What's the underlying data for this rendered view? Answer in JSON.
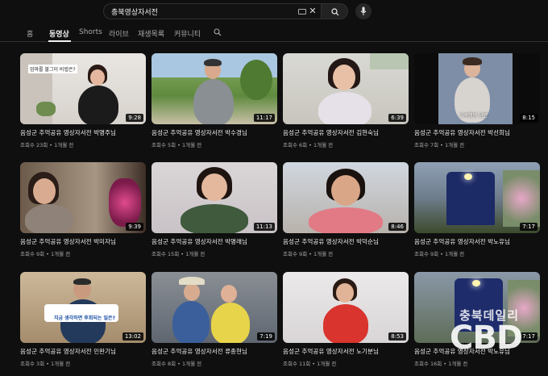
{
  "search": {
    "query": "충북영상자서전"
  },
  "tabs": [
    {
      "label": "홈"
    },
    {
      "label": "동영상"
    },
    {
      "label": "Shorts"
    },
    {
      "label": "라이브"
    },
    {
      "label": "재생목록"
    },
    {
      "label": "커뮤니티"
    }
  ],
  "videos": [
    {
      "title": "음성군 추억공유 영상자서전 박명주님",
      "views": "조회수 23회",
      "age": "1개월 전",
      "duration": "9:28",
      "overlay": "엄마를 불그이 비법은?"
    },
    {
      "title": "음성군 추억공유 영상자서전 박수경님",
      "views": "조회수 5회",
      "age": "1개월 전",
      "duration": "11:17",
      "overlay": ""
    },
    {
      "title": "음성군 추억공유 영상자서전 김현숙님",
      "views": "조회수 6회",
      "age": "1개월 전",
      "duration": "6:39",
      "overlay": ""
    },
    {
      "title": "음성군 추억공유 영상자서전 박선희님",
      "views": "조회수 7회",
      "age": "1개월 전",
      "duration": "8:15",
      "overlay": "이속했던 남편"
    },
    {
      "title": "음성군 추억공유 영상자서전 박미자님",
      "views": "조회수 9회",
      "age": "1개월 전",
      "duration": "9:39",
      "overlay": ""
    },
    {
      "title": "음성군 추억공유 영상자서전 박명래님",
      "views": "조회수 15회",
      "age": "1개월 전",
      "duration": "11:13",
      "overlay": ""
    },
    {
      "title": "음성군 추억공유 영상자서전 박덕순님",
      "views": "조회수 9회",
      "age": "1개월 전",
      "duration": "8:46",
      "overlay": ""
    },
    {
      "title": "음성군 추억공유 영상자서전 박노유님",
      "views": "조회수 9회",
      "age": "1개월 전",
      "duration": "7:17",
      "overlay": ""
    },
    {
      "title": "음성군 추억공유 영상자서전 민완기님",
      "views": "조회수 3회",
      "age": "1개월 전",
      "duration": "13:02",
      "overlay": "지금 생각하면 후회되는 일은?"
    },
    {
      "title": "음성군 추억공유 영상자서전 류종현님",
      "views": "조회수 8회",
      "age": "1개월 전",
      "duration": "7:19",
      "overlay": ""
    },
    {
      "title": "음성군 추억공유 영상자서전 노기분님",
      "views": "조회수 11회",
      "age": "1개월 전",
      "duration": "8:53",
      "overlay": ""
    },
    {
      "title": "음성군 추억공유 영상자서전 박노유님",
      "views": "조회수 16회",
      "age": "1개월 전",
      "duration": "7:17",
      "overlay": ""
    }
  ],
  "watermark": {
    "line1": "충북데일리",
    "line2": "CBD"
  },
  "icons": [
    "keyboard-icon",
    "clear-icon",
    "search-icon",
    "mic-icon",
    "tab-search-icon"
  ]
}
